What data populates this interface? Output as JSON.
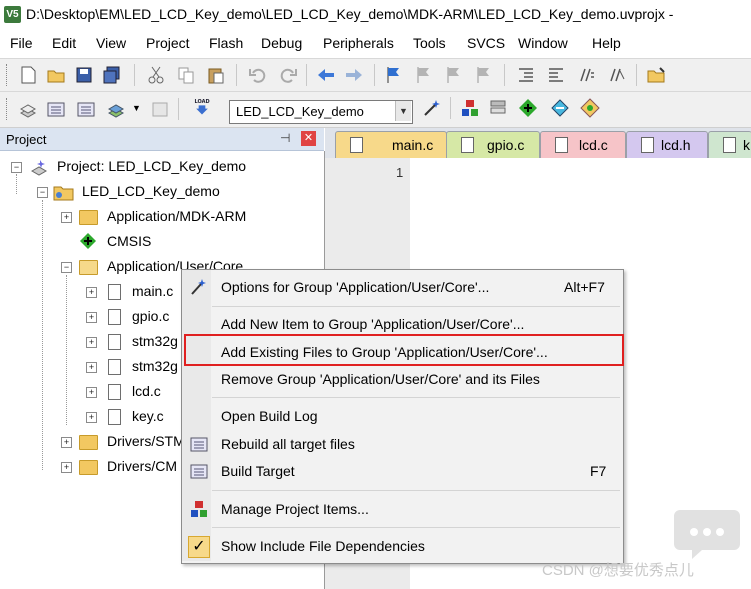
{
  "window": {
    "title": "D:\\Desktop\\EM\\LED_LCD_Key_demo\\LED_LCD_Key_demo\\MDK-ARM\\LED_LCD_Key_demo.uvprojx -",
    "app_icon_label": "V5"
  },
  "menu": [
    "File",
    "Edit",
    "View",
    "Project",
    "Flash",
    "Debug",
    "Peripherals",
    "Tools",
    "SVCS",
    "Window",
    "Help"
  ],
  "toolbar2": {
    "target_value": "LED_LCD_Key_demo",
    "load_label": "LOAD"
  },
  "project_panel": {
    "title": "Project",
    "tree": {
      "root": "Project: LED_LCD_Key_demo",
      "target": "LED_LCD_Key_demo",
      "groups": [
        "Application/MDK-ARM",
        "CMSIS",
        "Application/User/Core",
        "Drivers/STM",
        "Drivers/CM"
      ],
      "files": [
        "main.c",
        "gpio.c",
        "stm32g",
        "stm32g",
        "lcd.c",
        "key.c"
      ]
    }
  },
  "tabs": [
    "main.c",
    "gpio.c",
    "lcd.c",
    "lcd.h",
    "k"
  ],
  "editor": {
    "line_number": "1"
  },
  "context_menu": {
    "items": [
      {
        "label": "Options for Group 'Application/User/Core'...",
        "shortcut": "Alt+F7"
      },
      {
        "label": "Add New  Item to Group 'Application/User/Core'...",
        "shortcut": ""
      },
      {
        "label": "Add Existing Files to Group 'Application/User/Core'...",
        "shortcut": ""
      },
      {
        "label": "Remove Group 'Application/User/Core' and its Files",
        "shortcut": ""
      },
      {
        "label": "Open Build Log",
        "shortcut": ""
      },
      {
        "label": "Rebuild all target files",
        "shortcut": ""
      },
      {
        "label": "Build Target",
        "shortcut": "F7"
      },
      {
        "label": "Manage Project Items...",
        "shortcut": ""
      },
      {
        "label": "Show Include File Dependencies",
        "shortcut": ""
      }
    ]
  },
  "watermark": "CSDN @想要优秀点儿",
  "colors": {
    "highlight_border": "#e02020",
    "tab_main": "#f7d98a",
    "tab_gpio": "#d6e8a6",
    "tab_lcd_c": "#f6c4c8",
    "tab_lcd_h": "#d4c8ef",
    "tab_k": "#cfe6cf"
  }
}
